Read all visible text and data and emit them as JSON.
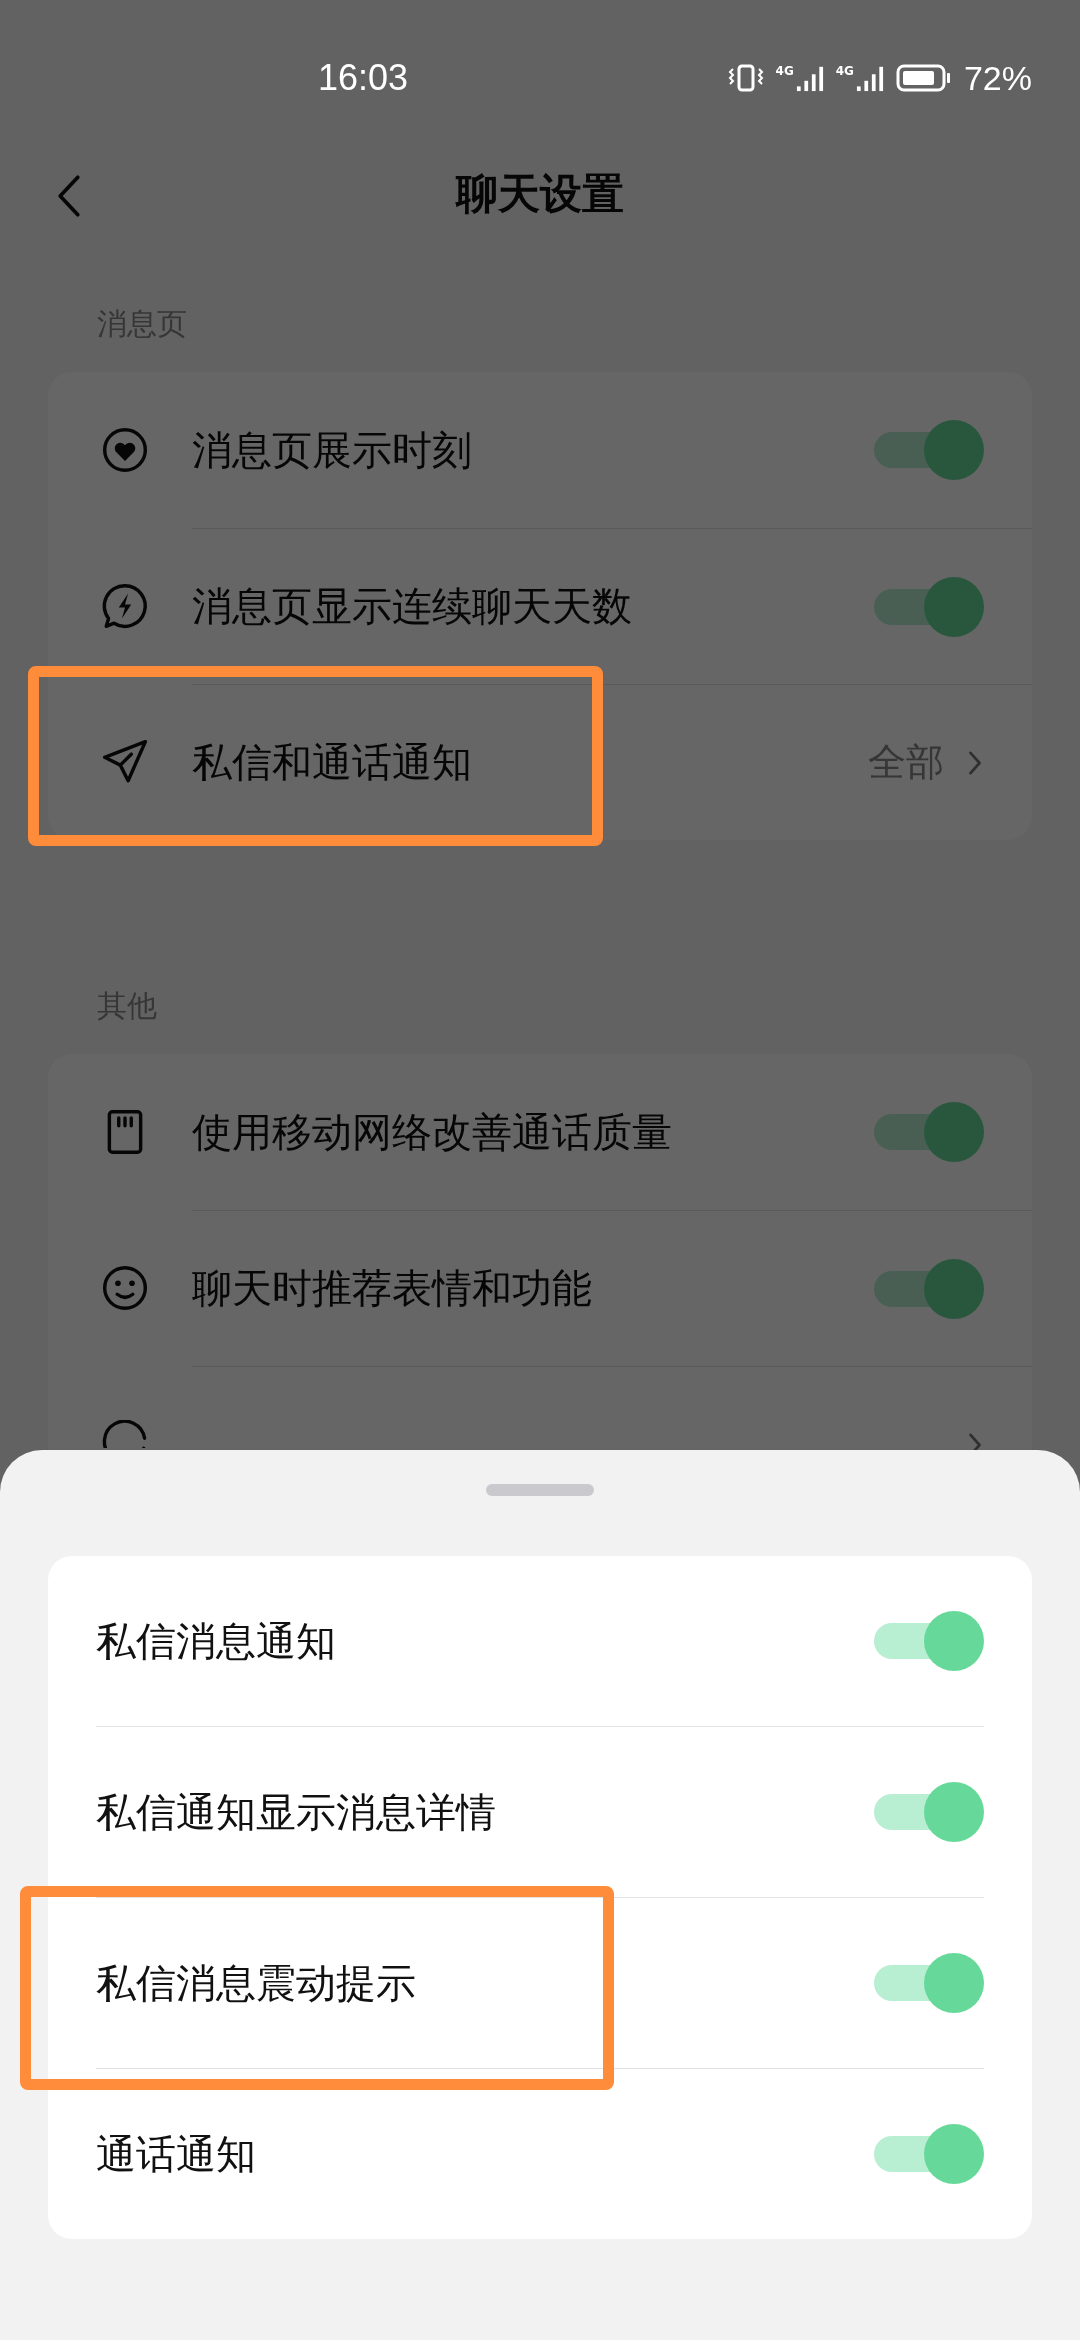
{
  "status_bar": {
    "time": "16:03",
    "network": [
      "4G",
      "4G"
    ],
    "battery": "72%"
  },
  "header": {
    "title": "聊天设置"
  },
  "sections": [
    {
      "title": "消息页",
      "items": [
        {
          "kind": "toggle",
          "label": "消息页展示时刻",
          "on": true,
          "highlighted": false
        },
        {
          "kind": "toggle",
          "label": "消息页显示连续聊天天数",
          "on": true,
          "highlighted": false
        },
        {
          "kind": "link",
          "label": "私信和通话通知",
          "value": "全部",
          "highlighted": true
        }
      ]
    },
    {
      "title": "其他",
      "items": [
        {
          "kind": "toggle",
          "label": "使用移动网络改善通话质量",
          "on": true,
          "highlighted": false
        },
        {
          "kind": "toggle",
          "label": "聊天时推荐表情和功能",
          "on": true,
          "highlighted": false
        },
        {
          "kind": "link",
          "highlighted": false
        }
      ]
    }
  ],
  "sheet": {
    "items": [
      {
        "label": "私信消息通知",
        "on": true,
        "highlighted": false
      },
      {
        "label": "私信通知显示消息详情",
        "on": true,
        "highlighted": false
      },
      {
        "label": "私信消息震动提示",
        "on": true,
        "highlighted": true
      },
      {
        "label": "通话通知",
        "on": true,
        "highlighted": false
      }
    ]
  }
}
